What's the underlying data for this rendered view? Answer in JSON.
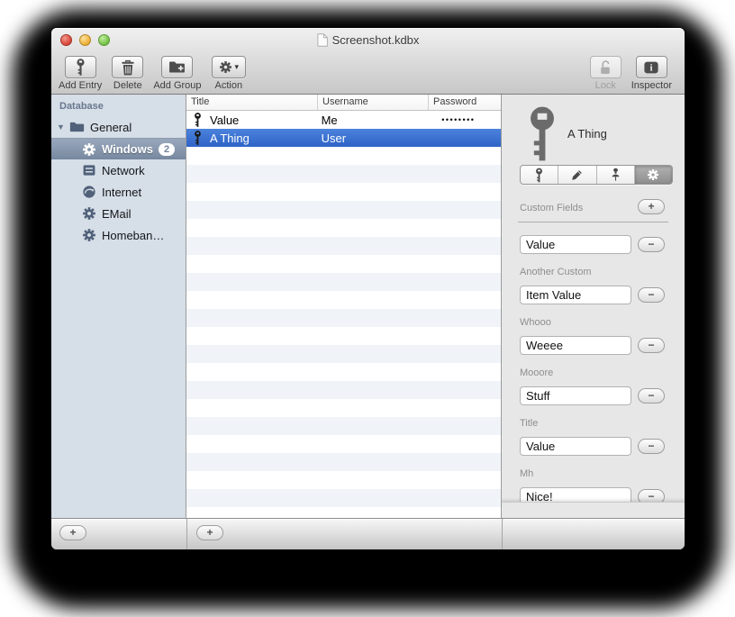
{
  "window": {
    "title": "Screenshot.kdbx"
  },
  "toolbar": {
    "items": [
      {
        "label": "Add Entry",
        "icon": "key"
      },
      {
        "label": "Delete",
        "icon": "trash"
      },
      {
        "label": "Add Group",
        "icon": "folder-plus"
      },
      {
        "label": "Action",
        "icon": "gear",
        "has_dropdown": true,
        "dropdown_glyph": "▾"
      }
    ],
    "right_items": [
      {
        "label": "Lock",
        "icon": "lock-open",
        "disabled": true
      },
      {
        "label": "Inspector",
        "icon": "info"
      }
    ]
  },
  "sidebar": {
    "header": "Database",
    "items": [
      {
        "label": "General",
        "icon": "folder",
        "depth": 0,
        "disclosure": "▼",
        "expanded": true
      },
      {
        "label": "Windows",
        "icon": "gear",
        "depth": 1,
        "selected": true,
        "badge": "2"
      },
      {
        "label": "Network",
        "icon": "network",
        "depth": 1
      },
      {
        "label": "Internet",
        "icon": "globe",
        "depth": 1
      },
      {
        "label": "EMail",
        "icon": "gear",
        "depth": 1
      },
      {
        "label": "Homeban…",
        "icon": "gear",
        "depth": 1
      }
    ],
    "add_label": "+"
  },
  "table": {
    "columns": [
      "Title",
      "Username",
      "Password"
    ],
    "rows": [
      {
        "title": "Value",
        "username": "Me",
        "password": "••••••••",
        "selected": false
      },
      {
        "title": "A Thing",
        "username": "User",
        "password": "",
        "selected": true
      }
    ],
    "empty_row_count": 21,
    "add_label": "+"
  },
  "inspector": {
    "entry_title": "A Thing",
    "tabs": [
      {
        "icon": "key"
      },
      {
        "icon": "pencil"
      },
      {
        "icon": "pin"
      },
      {
        "icon": "gear",
        "selected": true
      }
    ],
    "custom_fields_label": "Custom Fields",
    "add_field_label": "+",
    "remove_field_label": "−",
    "fields": [
      {
        "label": "",
        "value": "Value"
      },
      {
        "label": "Another Custom",
        "value": "Item Value"
      },
      {
        "label": "Whooo",
        "value": "Weeee"
      },
      {
        "label": "Mooore",
        "value": "Stuff"
      },
      {
        "label": "Title",
        "value": "Value"
      },
      {
        "label": "Mh",
        "value": "Nice!"
      }
    ]
  },
  "colors": {
    "selection_blue": "#3a76d6",
    "sidebar_selection": "#8496ae",
    "sidebar_bg": "#d6dee7",
    "alt_row": "#f0f4f9"
  }
}
